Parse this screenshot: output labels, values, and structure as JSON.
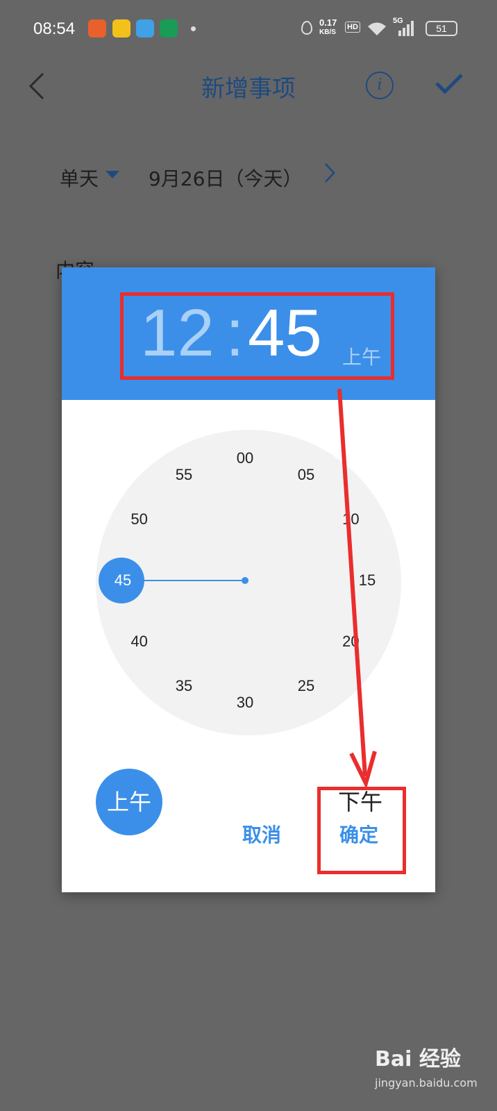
{
  "status_bar": {
    "time": "08:54",
    "net_speed": "0.17",
    "net_unit": "KB/S",
    "hd": "HD",
    "signal": "5G",
    "battery": "51"
  },
  "header": {
    "title": "新增事项"
  },
  "form": {
    "repeat_label": "单天",
    "date": "9月26日（今天）",
    "content_label": "内容"
  },
  "picker": {
    "hour": "12",
    "sep": ":",
    "minute": "45",
    "ampm_header": "上午",
    "selected_minute": "45",
    "minutes": [
      "00",
      "05",
      "10",
      "15",
      "20",
      "25",
      "30",
      "35",
      "40",
      "45",
      "50",
      "55"
    ],
    "am_label": "上午",
    "pm_label": "下午",
    "cancel": "取消",
    "ok": "确定"
  },
  "watermark": {
    "line1": "Bai 经验",
    "line2": "jingyan.baidu.com"
  },
  "colors": {
    "accent": "#3b8fe9",
    "highlight": "#ea2d2d",
    "scrim": "#666666"
  }
}
